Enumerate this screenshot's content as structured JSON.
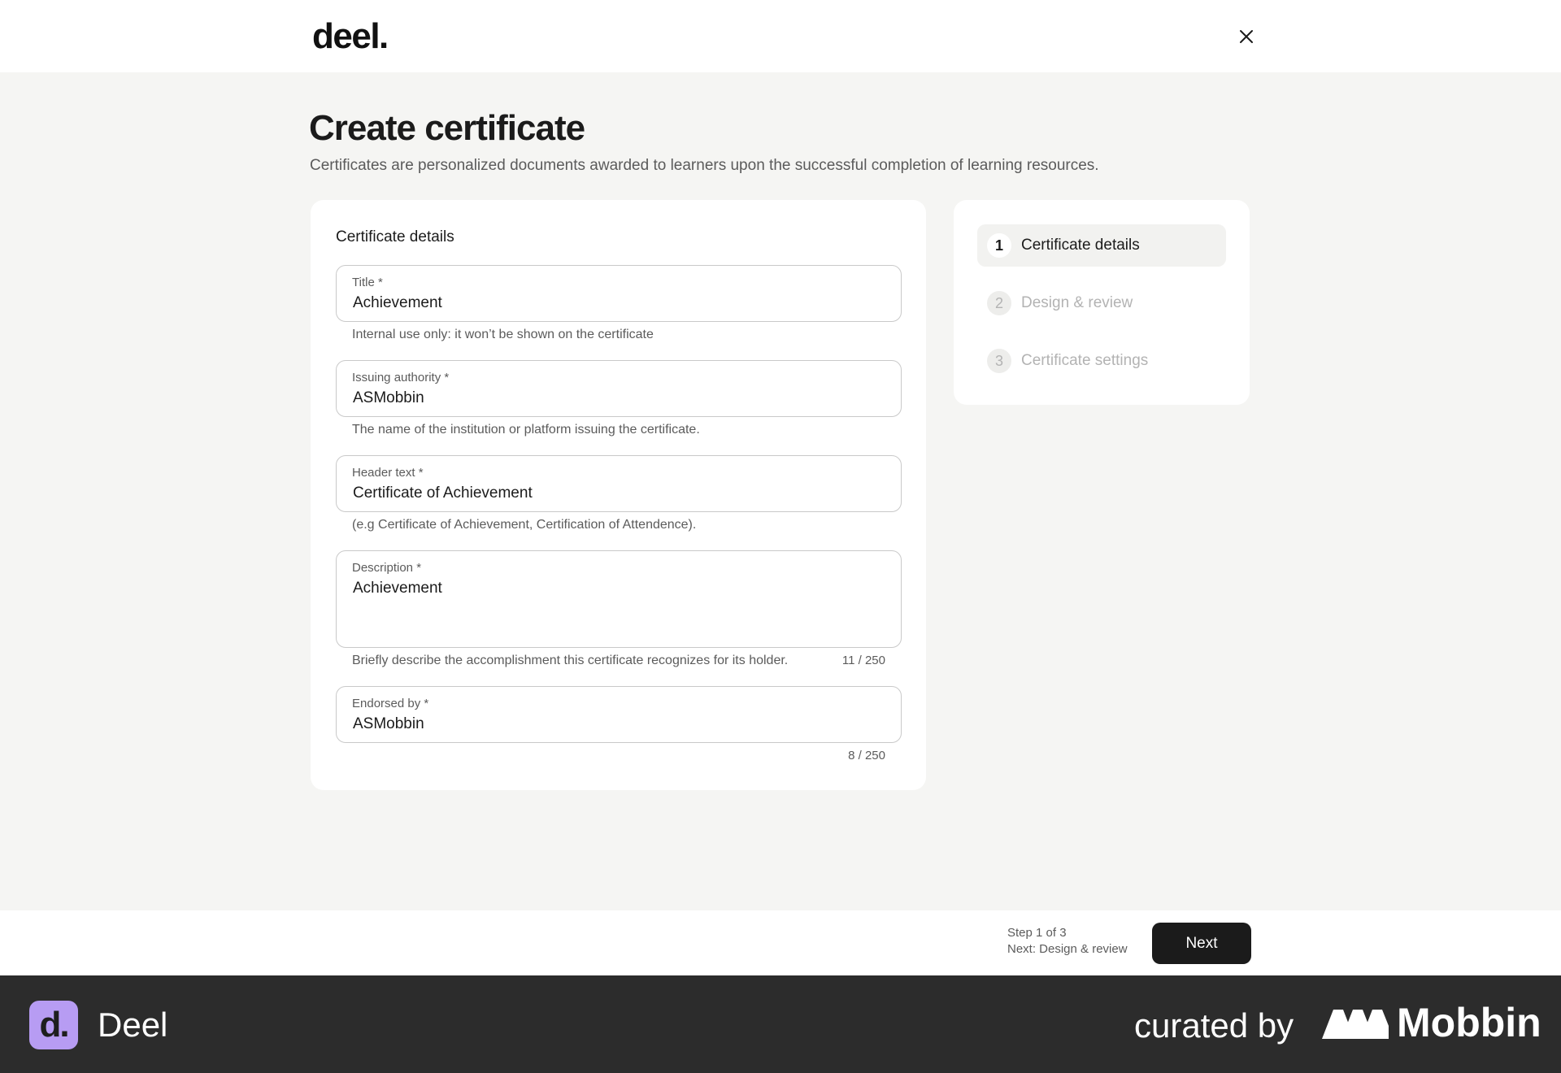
{
  "header": {
    "logo": "deel.",
    "close_icon": "close-icon"
  },
  "page": {
    "title": "Create certificate",
    "subtitle": "Certificates are personalized documents awarded to learners upon the successful completion of learning resources."
  },
  "form": {
    "heading": "Certificate details",
    "title_field": {
      "label": "Title *",
      "value": "Achievement",
      "hint": "Internal use only: it won’t be shown on the certificate"
    },
    "issuer_field": {
      "label": "Issuing authority *",
      "value": "ASMobbin",
      "hint": "The name of the institution or platform issuing the certificate."
    },
    "header_field": {
      "label": "Header text *",
      "value": "Certificate of Achievement",
      "hint": "(e.g Certificate of Achievement, Certification of Attendence)."
    },
    "description_field": {
      "label": "Description *",
      "value": "Achievement",
      "hint": "Briefly describe the accomplishment this certificate recognizes for its holder.",
      "counter": "11 / 250"
    },
    "endorsed_field": {
      "label": "Endorsed by *",
      "value": "ASMobbin",
      "counter": "8 / 250"
    }
  },
  "steps": [
    {
      "num": "1",
      "label": "Certificate details",
      "state": "active"
    },
    {
      "num": "2",
      "label": "Design & review",
      "state": "inactive"
    },
    {
      "num": "3",
      "label": "Certificate settings",
      "state": "inactive"
    }
  ],
  "footer_nav": {
    "step_text": "Step 1 of 3",
    "next_text": "Next: Design & review",
    "next_button": "Next"
  },
  "branding": {
    "app_badge": "d.",
    "app_name": "Deel",
    "curated": "curated by",
    "mobbin": "Mobbin"
  },
  "colors": {
    "background": "#f5f5f3",
    "primary_button": "#1b1b1b",
    "deel_badge": "#b79cf3",
    "footer": "#2c2c2c"
  }
}
